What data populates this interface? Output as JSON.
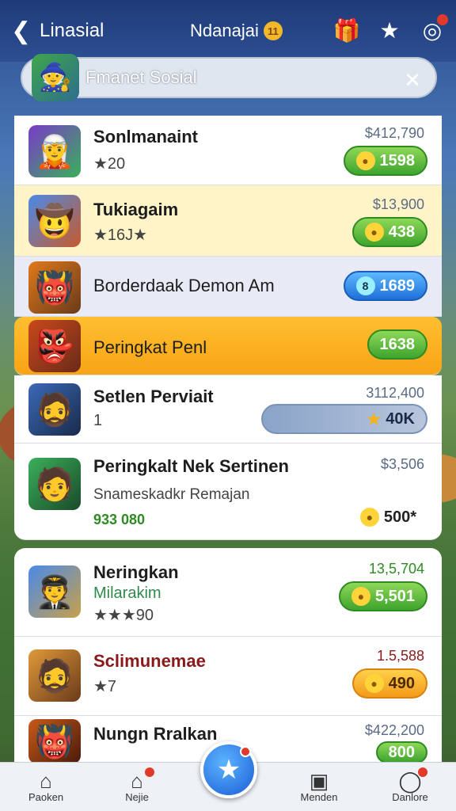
{
  "header": {
    "back_icon": "chevron-left-icon",
    "title": "Linasial",
    "balance_label": "Ndanajai",
    "balance_amount": "$11",
    "icons": [
      "gift-icon",
      "star-icon",
      "notification-icon"
    ]
  },
  "search": {
    "value": "Fmanet Sosial",
    "close_icon": "close-icon"
  },
  "rows": [
    {
      "name": "Sonlmanaint",
      "sub": "★20",
      "price": "$412,790",
      "pill": "1598",
      "pill_color": "green"
    },
    {
      "name": "Tukiagaim",
      "sub": "★16J★",
      "price": "$13,900",
      "pill": "438",
      "pill_color": "green"
    },
    {
      "name": "Borderdaak Demon Am",
      "sub": "",
      "price": "",
      "pill": "1689",
      "pill_color": "blue"
    },
    {
      "name": "Peringkat Penl",
      "sub": "",
      "price": "",
      "pill": "1638",
      "pill_color": "green"
    },
    {
      "name": "Setlen Perviait",
      "sub": "1",
      "price": "3112,400",
      "pill": "40K",
      "pill_color": "blue"
    },
    {
      "name": "Peringkalt Nek Sertinen",
      "sub": "Snameskadkr Remajan",
      "sub2": "933 080",
      "price": "$3,506",
      "pill": "500*",
      "pill_color": "plain"
    },
    {
      "name": "Neringkan",
      "sub": "Milarakim",
      "sub2": "★★★90",
      "price": "13,5,704",
      "pill": "5,501",
      "pill_color": "green"
    },
    {
      "name": "Sclimunemae",
      "sub": "★7",
      "price": "1.5,588",
      "pill": "490",
      "pill_color": "orange"
    },
    {
      "name": "Nungn Rralkan",
      "sub": "",
      "price": "$422,200",
      "pill": "800",
      "pill_color": "green"
    }
  ],
  "nav": {
    "home": "Paoken",
    "second": "Nejie",
    "fourth": "Menden",
    "fifth": "Danlore"
  }
}
